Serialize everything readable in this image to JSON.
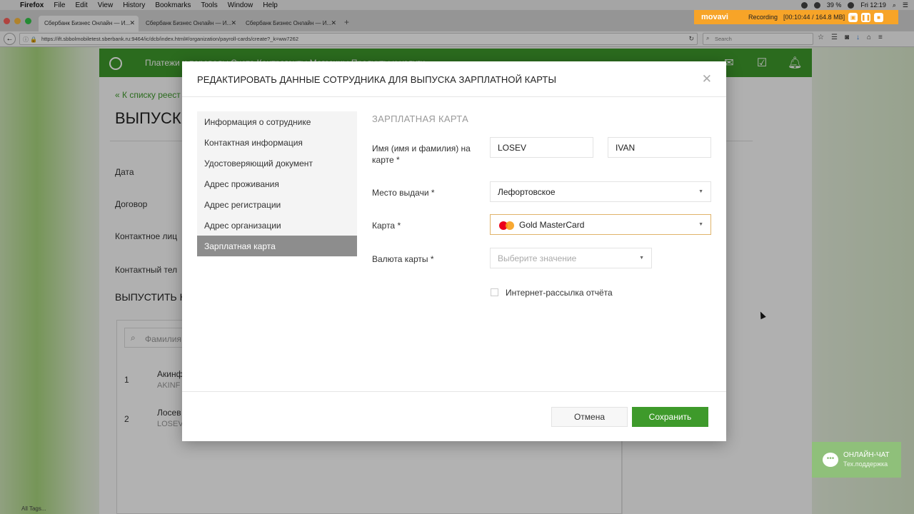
{
  "mac_menu": {
    "items": [
      "Firefox",
      "File",
      "Edit",
      "View",
      "History",
      "Bookmarks",
      "Tools",
      "Window",
      "Help"
    ],
    "battery": "39 %",
    "clock": "Fri 12:19"
  },
  "recording": {
    "logo": "movavi",
    "label": "Recording",
    "time": "[00:10:44 / 164.8 MB]"
  },
  "browser": {
    "tabs": [
      {
        "title": "Сбербанк Бизнес Онлайн — И..."
      },
      {
        "title": "Сбербанк Бизнес Онлайн — И..."
      },
      {
        "title": "Сбербанк Бизнес Онлайн — И..."
      }
    ],
    "url": "https://ift.sbbolmobiletest.sberbank.ru:9464/ic/dcb/index.html#/organization/payroll-cards/create?_k=ww7262",
    "search_placeholder": "Search"
  },
  "site": {
    "nav_text": "Платежи и переводы      Счета      Контрагенты      Магазины      Продукты и услуги"
  },
  "page": {
    "back_link": "« К списку реест",
    "title": "ВЫПУСК",
    "fields": [
      "Дата",
      "Договор",
      "Контактное лиц",
      "Контактный тел"
    ],
    "section_title": "ВЫПУСТИТЬ К",
    "search_placeholder": "Фамилия",
    "rows": [
      {
        "num": "1",
        "name": "Акинф",
        "latin": "AKINF"
      },
      {
        "num": "2",
        "name": "Лосев",
        "latin": "LOSEV"
      }
    ],
    "status_strip": "All Tags..."
  },
  "chat": {
    "title": "ОНЛАЙН-ЧАТ",
    "subtitle": "Тех.поддержка"
  },
  "modal": {
    "title": "РЕДАКТИРОВАТЬ ДАННЫЕ СОТРУДНИКА ДЛЯ ВЫПУСКА ЗАРПЛАТНОЙ КАРТЫ",
    "nav": [
      "Информация о сотруднике",
      "Контактная информация",
      "Удостоверяющий документ",
      "Адрес проживания",
      "Адрес регистрации",
      "Адрес организации",
      "Зарплатная карта"
    ],
    "section": "ЗАРПЛАТНАЯ КАРТА",
    "form": {
      "name_label": "Имя (имя и фамилия) на карте *",
      "last_name": "LOSEV",
      "first_name": "IVAN",
      "issue_place_label": "Место выдачи *",
      "issue_place": "Лефортовское",
      "card_label": "Карта *",
      "card": "Gold MasterCard",
      "currency_label": "Валюта карты *",
      "currency_placeholder": "Выберите значение",
      "newsletter_label": "Интернет-рассылка отчёта"
    },
    "buttons": {
      "cancel": "Отмена",
      "save": "Сохранить"
    }
  },
  "colors": {
    "brand_green": "#3e9a2b",
    "nav_active": "#8d8d8d",
    "recording_orange": "#f7a428",
    "mastercard_red": "#eb001b",
    "mastercard_orange": "#f79e1b"
  }
}
